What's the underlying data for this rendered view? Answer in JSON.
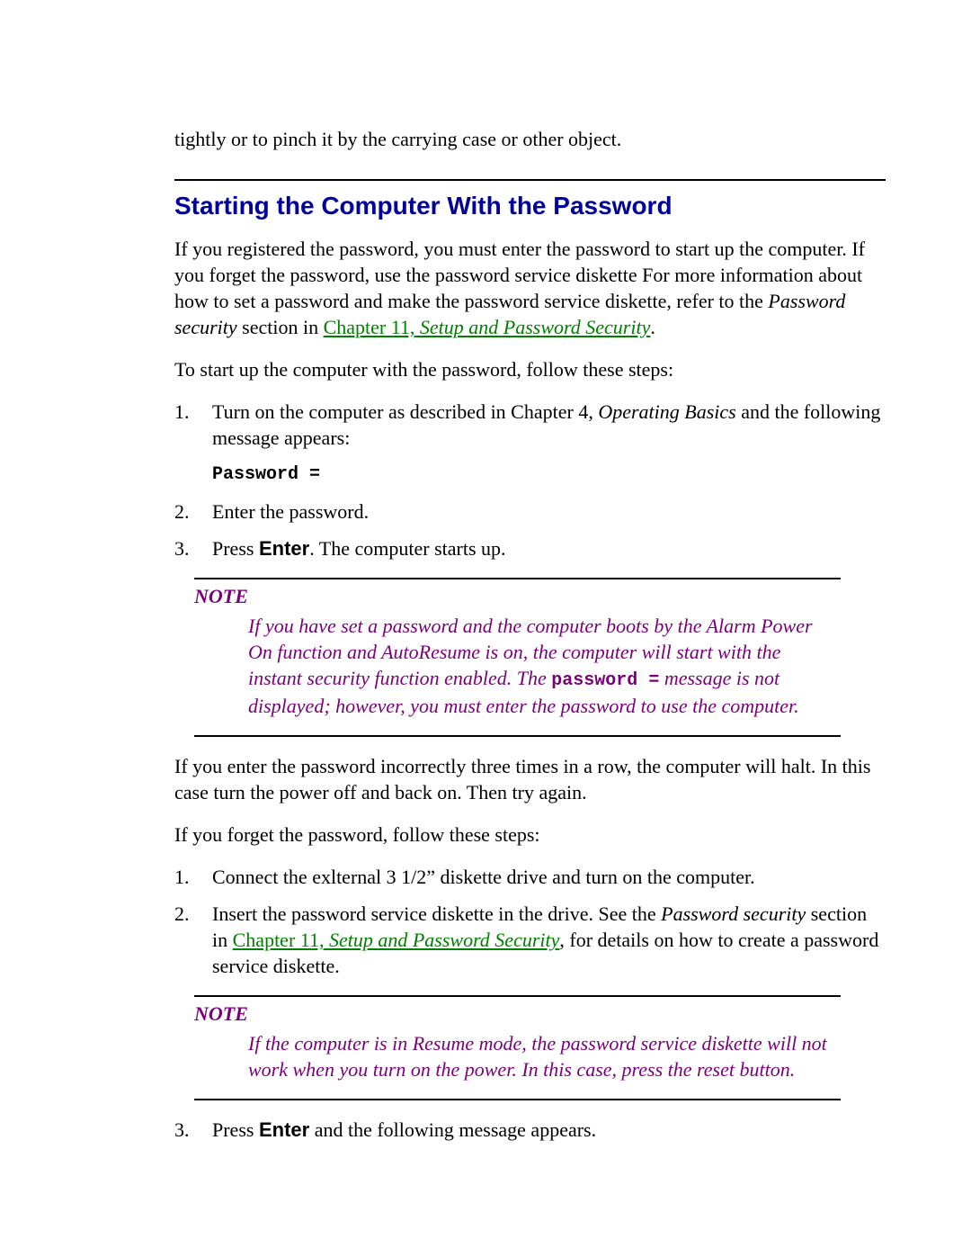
{
  "frag_top": "tightly or to pinch it by the carrying case or other object.",
  "heading": "Starting the Computer With the Password",
  "intro": {
    "pre": "If you registered the password, you must enter the password to start up the computer. If you forget the password, use the password service diskette For more information about how to set a password and make the password service diskette, refer to the ",
    "pwsec": "Password security",
    "mid": " section in ",
    "link_chap": "Chapter 11,",
    "link_title": " Setup and Password Security",
    "post": "."
  },
  "para2": "To start up the computer with the password, follow these steps:",
  "step1": {
    "pre": "Turn on the computer as described in Chapter 4, ",
    "ital": "Operating Basics",
    "post": " and the following message appears:",
    "prompt": "Password ="
  },
  "step2": "Enter the password.",
  "step3": {
    "pre": "Press ",
    "key": "Enter",
    "post": ". The computer starts up."
  },
  "note_label": "NOTE",
  "note1": {
    "t1": "If you have set a password and the computer boots by the Alarm Power On function and AutoResume is on, the computer will start with the instant security function enabled. The ",
    "mono": "password =",
    "t2": " message is not displayed; however, you must enter the password to use the computer."
  },
  "para3": "If you enter the password incorrectly three times in a row, the computer will halt. In this case turn the power off and back on. Then try again.",
  "para4": "If you forget the password, follow these steps:",
  "f_step1": "Connect the exlternal 3 1/2” diskette drive and turn on the computer.",
  "f_step2": {
    "pre": "Insert the password service diskette in the drive. See the ",
    "ital": "Password security",
    "mid": " section in ",
    "link_chap": "Chapter 11,",
    "link_title": " Setup and Password Security",
    "post": ",  for details on how to create a password service diskette."
  },
  "note2": "If the computer is in Resume mode, the password service diskette will not work when you turn on the power. In this case, press the reset button.",
  "f_step3": {
    "pre": "Press ",
    "key": "Enter",
    "post": " and the following message appears."
  }
}
